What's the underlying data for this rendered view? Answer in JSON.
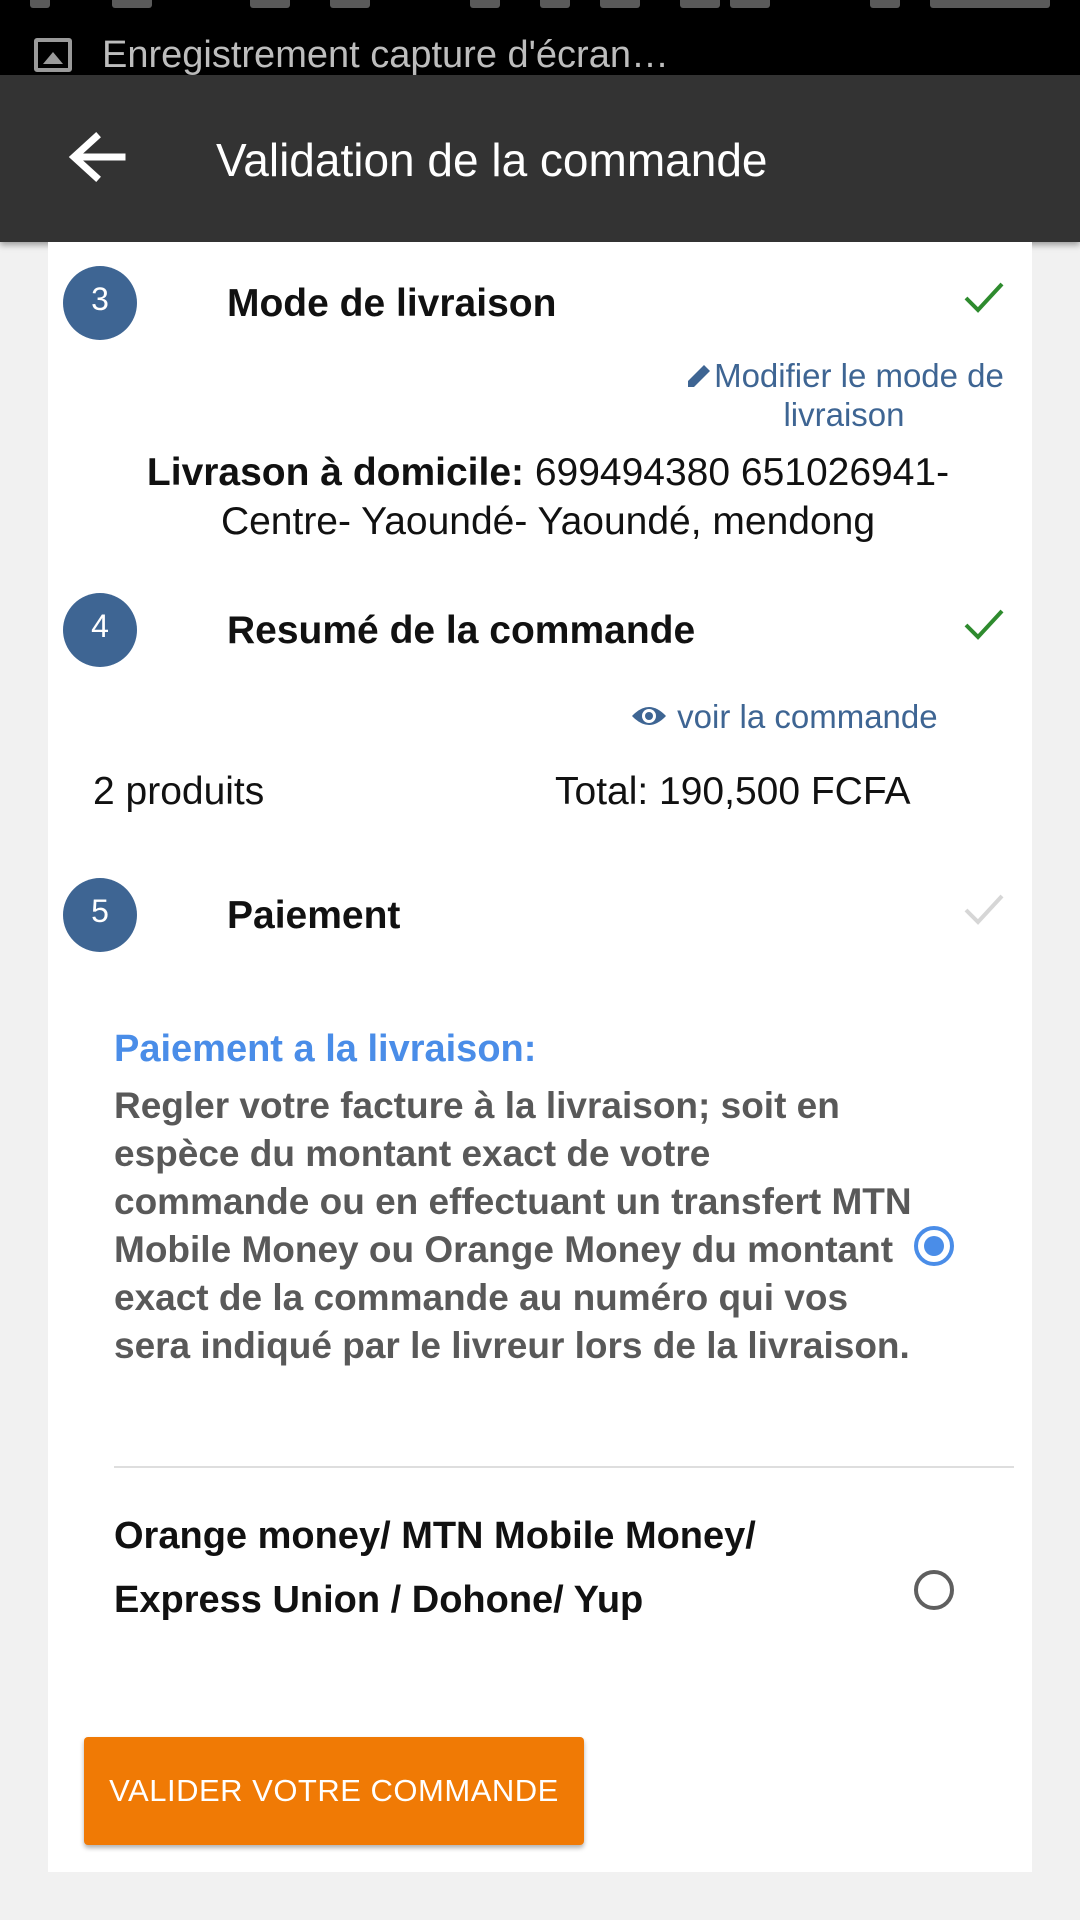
{
  "status_bar": {
    "notification_text": "Enregistrement capture d'écran…"
  },
  "app_bar": {
    "title": "Validation de la commande"
  },
  "steps": [
    {
      "number": "3",
      "title": "Mode de livraison",
      "completed": true
    },
    {
      "number": "4",
      "title": "Resumé de la commande",
      "completed": true
    },
    {
      "number": "5",
      "title": "Paiement",
      "completed": false
    }
  ],
  "delivery": {
    "modify_link": "Modifier le mode de livraison",
    "label": "Livrason à domicile:",
    "address": " 699494380 651026941- Centre- Yaoundé- Yaoundé, mendong"
  },
  "summary": {
    "view_link": "voir la commande",
    "products_count": "2 produits",
    "total": "Total: 190,500 FCFA"
  },
  "payment": {
    "option1_title": "Paiement a la livraison:",
    "option1_description": "Regler votre facture à la livraison; soit en espèce du montant exact de votre commande ou en effectuant un transfert MTN Mobile Money ou Orange Money du montant exact de la commande au numéro qui vos sera indiqué par le livreur lors de la livraison.",
    "option1_selected": true,
    "option2_label": "Orange money/ MTN Mobile Money/ Express Union / Dohone/ Yup",
    "option2_selected": false
  },
  "submit_button": "VALIDER VOTRE COMMANDE",
  "colors": {
    "app_bar": "#333333",
    "step_circle": "#3e6593",
    "check_done": "#2e8b2e",
    "check_pending": "#d6d6d6",
    "link": "#3e6593",
    "radio_selected": "#4a8de8",
    "submit_button": "#f07a05"
  },
  "icons": [
    "image-icon",
    "arrow-back-icon",
    "check-icon",
    "pencil-icon",
    "eye-icon"
  ]
}
